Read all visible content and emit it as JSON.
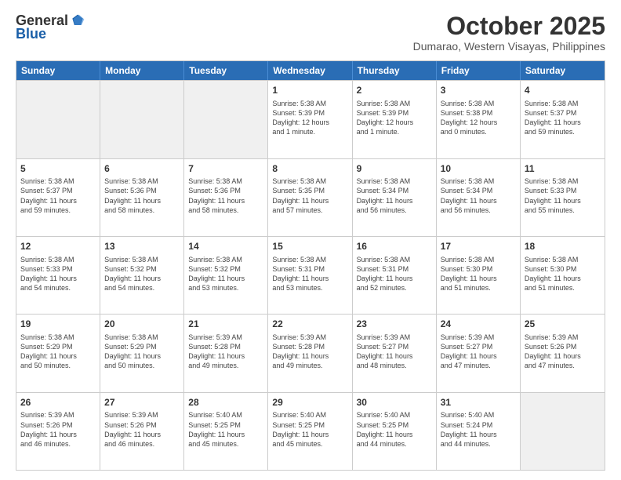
{
  "logo": {
    "general": "General",
    "blue": "Blue"
  },
  "header": {
    "month": "October 2025",
    "location": "Dumarao, Western Visayas, Philippines"
  },
  "weekdays": [
    "Sunday",
    "Monday",
    "Tuesday",
    "Wednesday",
    "Thursday",
    "Friday",
    "Saturday"
  ],
  "rows": [
    [
      {
        "day": "",
        "empty": true
      },
      {
        "day": "",
        "empty": true
      },
      {
        "day": "",
        "empty": true
      },
      {
        "day": "1",
        "lines": [
          "Sunrise: 5:38 AM",
          "Sunset: 5:39 PM",
          "Daylight: 12 hours",
          "and 1 minute."
        ]
      },
      {
        "day": "2",
        "lines": [
          "Sunrise: 5:38 AM",
          "Sunset: 5:39 PM",
          "Daylight: 12 hours",
          "and 1 minute."
        ]
      },
      {
        "day": "3",
        "lines": [
          "Sunrise: 5:38 AM",
          "Sunset: 5:38 PM",
          "Daylight: 12 hours",
          "and 0 minutes."
        ]
      },
      {
        "day": "4",
        "lines": [
          "Sunrise: 5:38 AM",
          "Sunset: 5:37 PM",
          "Daylight: 11 hours",
          "and 59 minutes."
        ]
      }
    ],
    [
      {
        "day": "5",
        "lines": [
          "Sunrise: 5:38 AM",
          "Sunset: 5:37 PM",
          "Daylight: 11 hours",
          "and 59 minutes."
        ]
      },
      {
        "day": "6",
        "lines": [
          "Sunrise: 5:38 AM",
          "Sunset: 5:36 PM",
          "Daylight: 11 hours",
          "and 58 minutes."
        ]
      },
      {
        "day": "7",
        "lines": [
          "Sunrise: 5:38 AM",
          "Sunset: 5:36 PM",
          "Daylight: 11 hours",
          "and 58 minutes."
        ]
      },
      {
        "day": "8",
        "lines": [
          "Sunrise: 5:38 AM",
          "Sunset: 5:35 PM",
          "Daylight: 11 hours",
          "and 57 minutes."
        ]
      },
      {
        "day": "9",
        "lines": [
          "Sunrise: 5:38 AM",
          "Sunset: 5:34 PM",
          "Daylight: 11 hours",
          "and 56 minutes."
        ]
      },
      {
        "day": "10",
        "lines": [
          "Sunrise: 5:38 AM",
          "Sunset: 5:34 PM",
          "Daylight: 11 hours",
          "and 56 minutes."
        ]
      },
      {
        "day": "11",
        "lines": [
          "Sunrise: 5:38 AM",
          "Sunset: 5:33 PM",
          "Daylight: 11 hours",
          "and 55 minutes."
        ]
      }
    ],
    [
      {
        "day": "12",
        "lines": [
          "Sunrise: 5:38 AM",
          "Sunset: 5:33 PM",
          "Daylight: 11 hours",
          "and 54 minutes."
        ]
      },
      {
        "day": "13",
        "lines": [
          "Sunrise: 5:38 AM",
          "Sunset: 5:32 PM",
          "Daylight: 11 hours",
          "and 54 minutes."
        ]
      },
      {
        "day": "14",
        "lines": [
          "Sunrise: 5:38 AM",
          "Sunset: 5:32 PM",
          "Daylight: 11 hours",
          "and 53 minutes."
        ]
      },
      {
        "day": "15",
        "lines": [
          "Sunrise: 5:38 AM",
          "Sunset: 5:31 PM",
          "Daylight: 11 hours",
          "and 53 minutes."
        ]
      },
      {
        "day": "16",
        "lines": [
          "Sunrise: 5:38 AM",
          "Sunset: 5:31 PM",
          "Daylight: 11 hours",
          "and 52 minutes."
        ]
      },
      {
        "day": "17",
        "lines": [
          "Sunrise: 5:38 AM",
          "Sunset: 5:30 PM",
          "Daylight: 11 hours",
          "and 51 minutes."
        ]
      },
      {
        "day": "18",
        "lines": [
          "Sunrise: 5:38 AM",
          "Sunset: 5:30 PM",
          "Daylight: 11 hours",
          "and 51 minutes."
        ]
      }
    ],
    [
      {
        "day": "19",
        "lines": [
          "Sunrise: 5:38 AM",
          "Sunset: 5:29 PM",
          "Daylight: 11 hours",
          "and 50 minutes."
        ]
      },
      {
        "day": "20",
        "lines": [
          "Sunrise: 5:38 AM",
          "Sunset: 5:29 PM",
          "Daylight: 11 hours",
          "and 50 minutes."
        ]
      },
      {
        "day": "21",
        "lines": [
          "Sunrise: 5:39 AM",
          "Sunset: 5:28 PM",
          "Daylight: 11 hours",
          "and 49 minutes."
        ]
      },
      {
        "day": "22",
        "lines": [
          "Sunrise: 5:39 AM",
          "Sunset: 5:28 PM",
          "Daylight: 11 hours",
          "and 49 minutes."
        ]
      },
      {
        "day": "23",
        "lines": [
          "Sunrise: 5:39 AM",
          "Sunset: 5:27 PM",
          "Daylight: 11 hours",
          "and 48 minutes."
        ]
      },
      {
        "day": "24",
        "lines": [
          "Sunrise: 5:39 AM",
          "Sunset: 5:27 PM",
          "Daylight: 11 hours",
          "and 47 minutes."
        ]
      },
      {
        "day": "25",
        "lines": [
          "Sunrise: 5:39 AM",
          "Sunset: 5:26 PM",
          "Daylight: 11 hours",
          "and 47 minutes."
        ]
      }
    ],
    [
      {
        "day": "26",
        "lines": [
          "Sunrise: 5:39 AM",
          "Sunset: 5:26 PM",
          "Daylight: 11 hours",
          "and 46 minutes."
        ]
      },
      {
        "day": "27",
        "lines": [
          "Sunrise: 5:39 AM",
          "Sunset: 5:26 PM",
          "Daylight: 11 hours",
          "and 46 minutes."
        ]
      },
      {
        "day": "28",
        "lines": [
          "Sunrise: 5:40 AM",
          "Sunset: 5:25 PM",
          "Daylight: 11 hours",
          "and 45 minutes."
        ]
      },
      {
        "day": "29",
        "lines": [
          "Sunrise: 5:40 AM",
          "Sunset: 5:25 PM",
          "Daylight: 11 hours",
          "and 45 minutes."
        ]
      },
      {
        "day": "30",
        "lines": [
          "Sunrise: 5:40 AM",
          "Sunset: 5:25 PM",
          "Daylight: 11 hours",
          "and 44 minutes."
        ]
      },
      {
        "day": "31",
        "lines": [
          "Sunrise: 5:40 AM",
          "Sunset: 5:24 PM",
          "Daylight: 11 hours",
          "and 44 minutes."
        ]
      },
      {
        "day": "",
        "empty": true
      }
    ]
  ]
}
